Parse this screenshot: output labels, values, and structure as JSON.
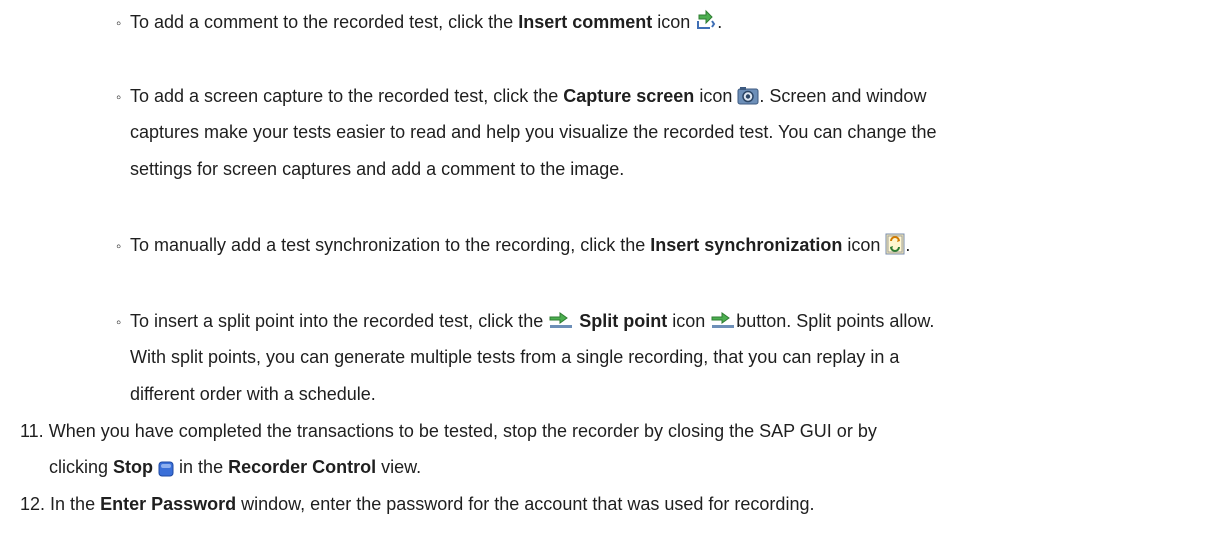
{
  "bullets": {
    "comment": {
      "t1": "To add a comment to the recorded test, click the ",
      "bold": "Insert comment",
      "t2": " icon ",
      "t3": ".",
      "icon": "insert-comment-icon"
    },
    "capture": {
      "t1": "To add a screen capture to the recorded test, click the ",
      "bold": "Capture screen",
      "t2": " icon ",
      "t3": ". Screen and window",
      "line2": "captures make your tests easier to read and help you visualize the recorded test. You can change the",
      "line3": "settings for screen captures and add a comment to the image.",
      "icon": "capture-screen-icon"
    },
    "sync": {
      "t1": "To manually add a test synchronization to the recording, click the ",
      "bold": "Insert synchronization",
      "t2": " icon ",
      "t3": ".",
      "icon": "insert-synchronization-icon"
    },
    "split": {
      "t1": "To insert a split point into the recorded test, click the ",
      "bold": "Split point",
      "t2": " icon ",
      "t3": "button. Split points allow.",
      "line2": "With split points, you can generate multiple tests from a single recording, that you can replay in a",
      "line3": "different order with a schedule.",
      "icon": "split-point-icon"
    }
  },
  "steps": {
    "s11": {
      "num": "11.",
      "line1": "When you have completed the transactions to be tested, stop the recorder by closing the SAP GUI or by",
      "l2a": "clicking ",
      "l2bold": "Stop",
      "l2b": " in the ",
      "l2bold2": "Recorder Control",
      "l2c": " view.",
      "icon": "stop-icon"
    },
    "s12": {
      "num": "12.",
      "t1": "In the ",
      "bold": "Enter Password",
      "t2": " window, enter the password for the account that was used for recording."
    }
  }
}
